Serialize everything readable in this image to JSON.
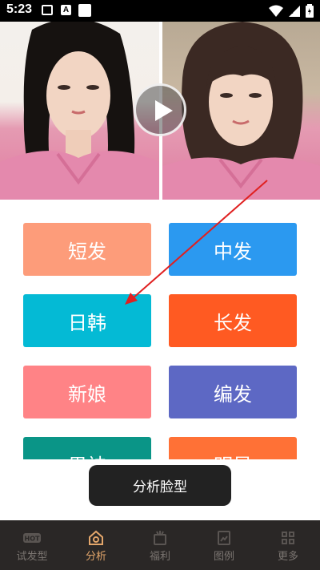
{
  "status_bar": {
    "time": "5:23"
  },
  "banner": {
    "play_icon": "play-icon"
  },
  "categories": [
    {
      "label": "短发",
      "color": "#FD9C7A"
    },
    {
      "label": "中发",
      "color": "#2B99F0"
    },
    {
      "label": "日韩",
      "color": "#04BAD5"
    },
    {
      "label": "长发",
      "color": "#FF5A22"
    },
    {
      "label": "新娘",
      "color": "#FF8386"
    },
    {
      "label": "编发",
      "color": "#5D68C4"
    },
    {
      "label": "男神",
      "color": "#0A9587"
    },
    {
      "label": "明星",
      "color": "#FF7136"
    }
  ],
  "analyze_button": {
    "label": "分析脸型"
  },
  "bottom_nav": {
    "items": [
      {
        "label": "试发型",
        "icon": "hot-icon",
        "active": false
      },
      {
        "label": "分析",
        "icon": "home-icon",
        "active": true
      },
      {
        "label": "福利",
        "icon": "gift-icon",
        "active": false
      },
      {
        "label": "图例",
        "icon": "picture-icon",
        "active": false
      },
      {
        "label": "更多",
        "icon": "grid-icon",
        "active": false
      }
    ]
  },
  "colors": {
    "arrow": "#E02020",
    "nav_active": "#E3A66B",
    "nav_inactive": "#7B7571",
    "nav_bg": "#2A2726"
  }
}
